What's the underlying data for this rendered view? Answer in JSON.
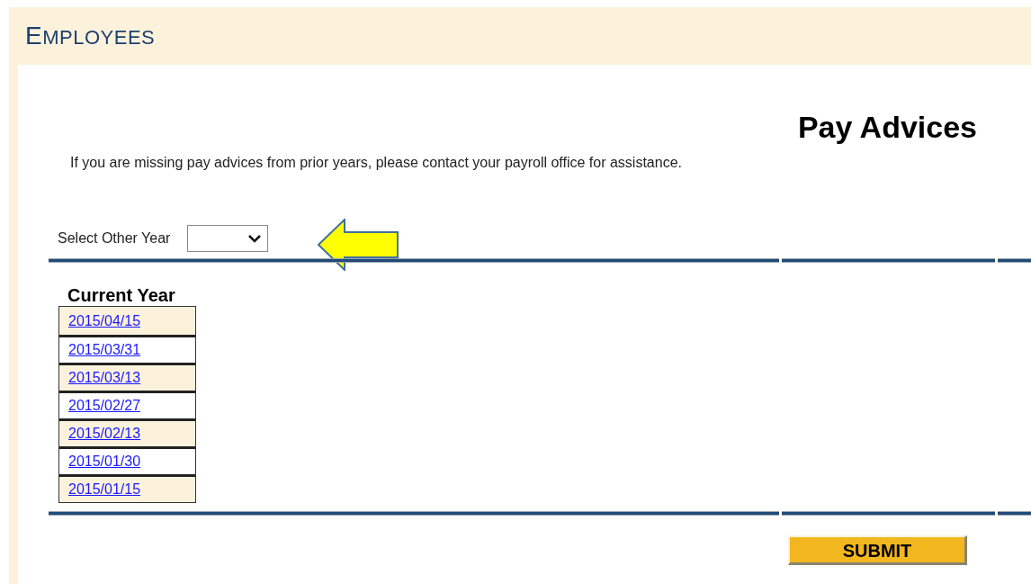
{
  "header": {
    "title": "EMPLOYEES"
  },
  "page_title": "Pay Advices",
  "notice": "If you are missing pay advices from prior years, please contact your payroll office for assistance.",
  "year_select": {
    "label": "Select Other Year"
  },
  "current_year": {
    "heading": "Current Year",
    "dates": [
      "2015/04/15",
      "2015/03/31",
      "2015/03/13",
      "2015/02/27",
      "2015/02/13",
      "2015/01/30",
      "2015/01/15"
    ]
  },
  "submit_button": "SUBMIT"
}
